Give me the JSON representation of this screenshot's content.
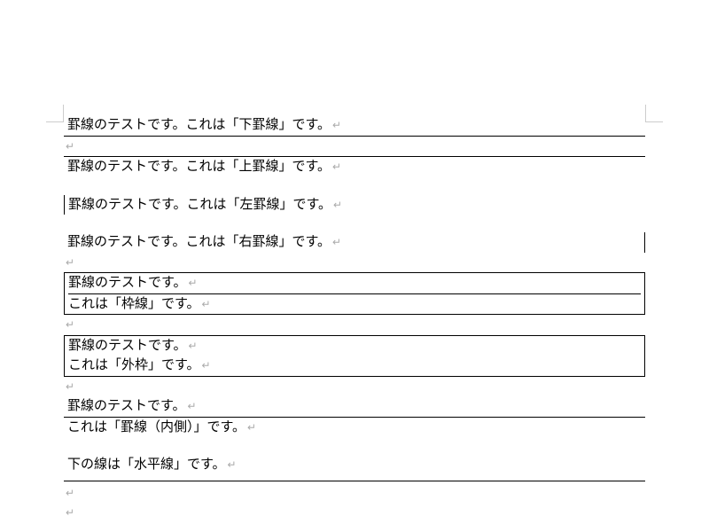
{
  "lines": {
    "bottom_border": "罫線のテストです。これは「下罫線」です。",
    "top_border": "罫線のテストです。これは「上罫線」です。",
    "left_border": "罫線のテストです。これは「左罫線」です。",
    "right_border": "罫線のテストです。これは「右罫線」です。",
    "box1_line1": "罫線のテストです。",
    "box1_line2": "これは「枠線」です。",
    "box2_line1": "罫線のテストです。",
    "box2_line2": "これは「外枠」です。",
    "inner_line1": "罫線のテストです。",
    "inner_line2": "これは「罫線（内側）」です。",
    "hr_label": "下の線は「水平線」です。"
  }
}
